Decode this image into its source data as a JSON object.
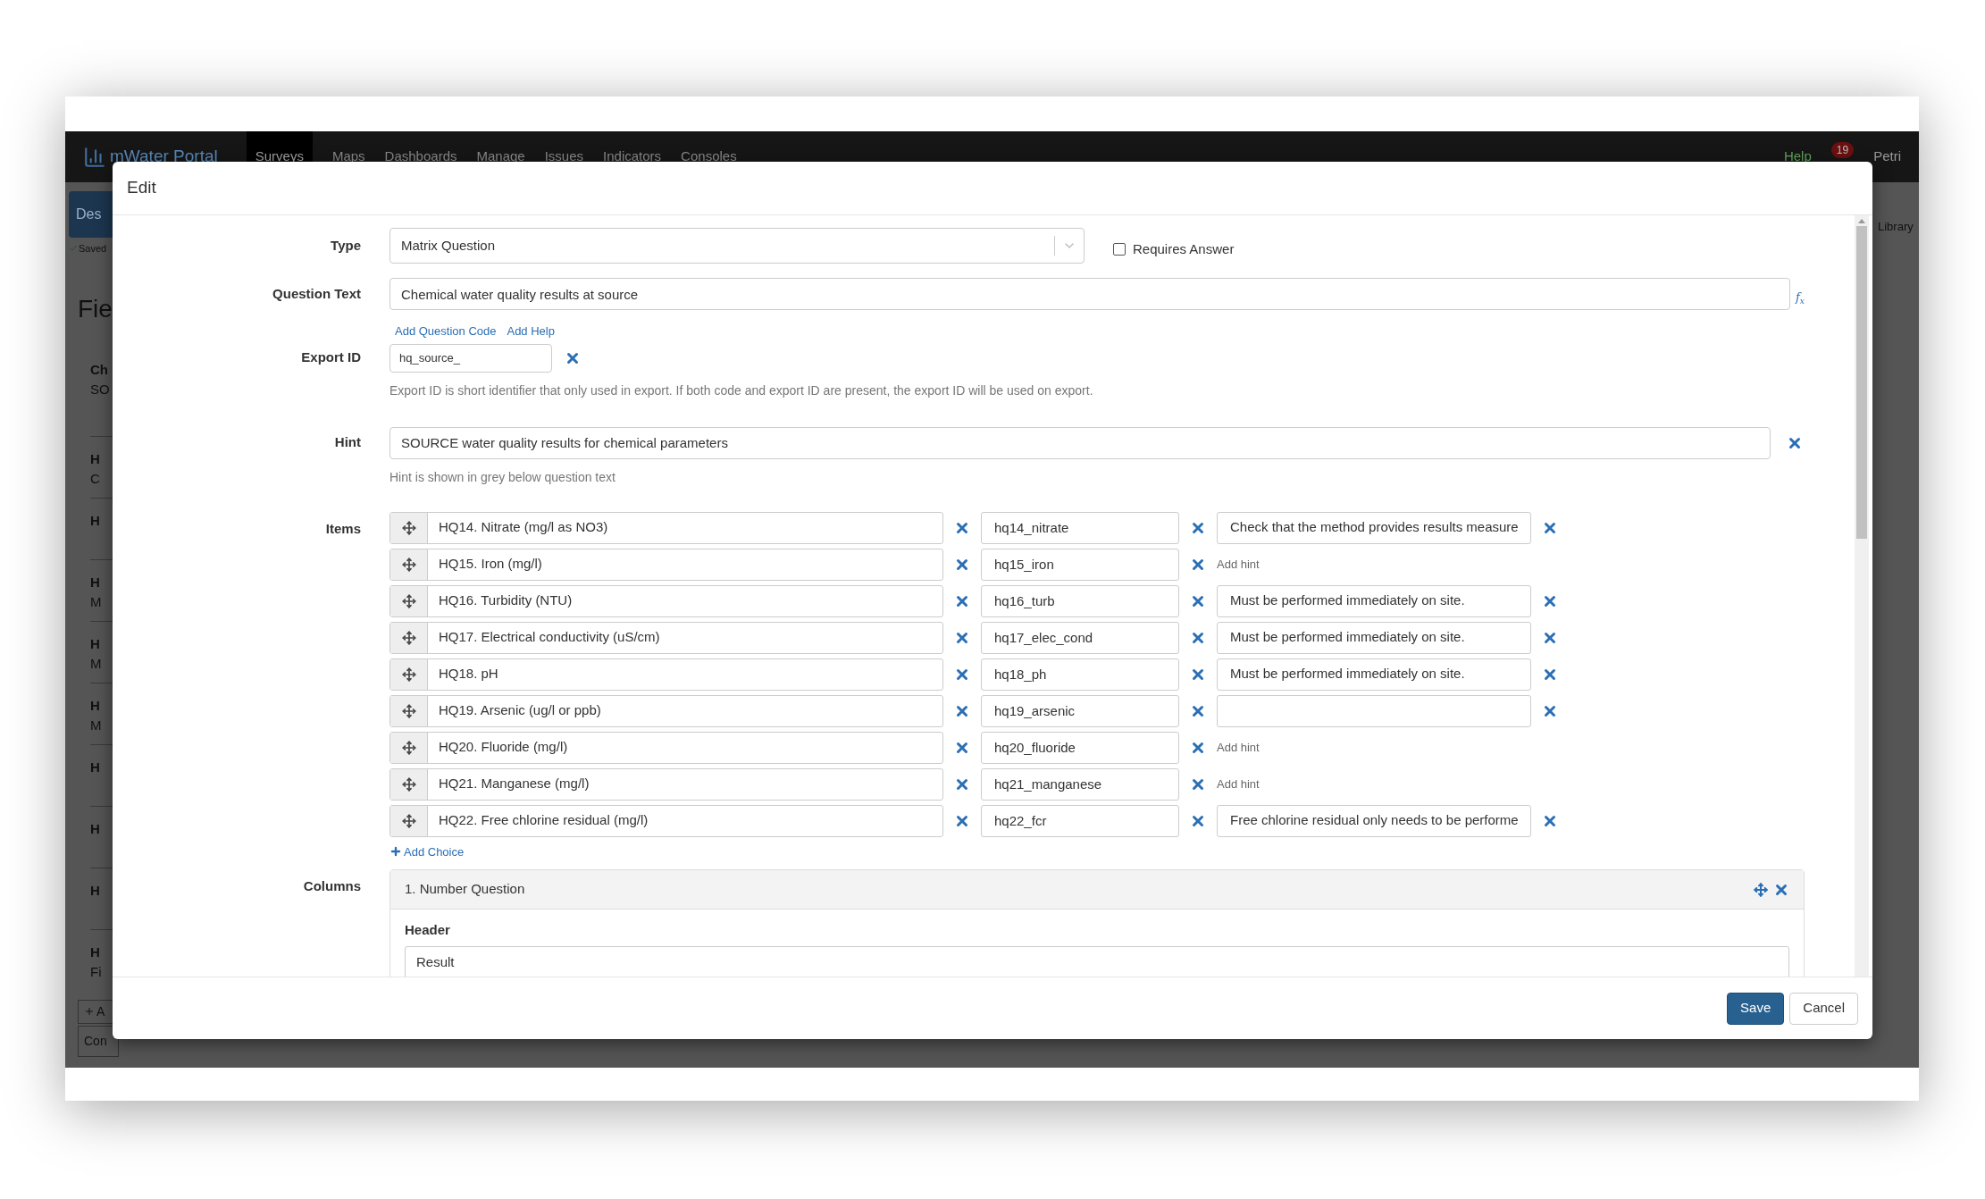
{
  "app": {
    "logo": "mWater Portal",
    "nav": [
      {
        "label": "Surveys",
        "selected": true
      },
      {
        "label": "Maps",
        "selected": false
      },
      {
        "label": "Dashboards",
        "selected": false
      },
      {
        "label": "Manage",
        "selected": false
      },
      {
        "label": "Issues",
        "selected": false
      },
      {
        "label": "Indicators",
        "selected": false
      },
      {
        "label": "Consoles",
        "selected": false
      }
    ],
    "help": "Help",
    "notifications": "19",
    "user": "Petri",
    "design_button": "Des",
    "saved": "Saved",
    "heading": "Fie",
    "library": "Library",
    "section": {
      "title": "Ch",
      "subtitle": "SO"
    },
    "rows": [
      {
        "title": "H",
        "subtitle": "C"
      },
      {
        "title": "H"
      },
      {
        "title": "H",
        "subtitle": "M"
      },
      {
        "title": "H",
        "subtitle": "M"
      },
      {
        "title": "H",
        "subtitle": "M"
      },
      {
        "title": "H"
      },
      {
        "title": "H"
      },
      {
        "title": "H"
      },
      {
        "title": "H",
        "subtitle": "Fi"
      }
    ],
    "add_button": "A",
    "bottom_button": "Con"
  },
  "dialog": {
    "title": "Edit",
    "type": {
      "label": "Type",
      "value": "Matrix Question"
    },
    "requires_answer": {
      "label": "Requires Answer",
      "checked": false
    },
    "question_text": {
      "label": "Question Text",
      "value": "Chemical water quality results at source",
      "formula": "f",
      "formula_sub": "x"
    },
    "links": [
      "Add Question Code",
      "Add Help"
    ],
    "export_id": {
      "label": "Export ID",
      "value": "hq_source_",
      "help": "Export ID is short identifier that only used in export. If both code and export ID are present, the export ID will be used on export."
    },
    "hint": {
      "label": "Hint",
      "value": "SOURCE water quality results for chemical parameters",
      "help": "Hint is shown in grey below question text"
    },
    "items_label": "Items",
    "items": [
      {
        "label": "HQ14. Nitrate (mg/l as NO3)",
        "code": "hq14_nitrate",
        "kind": "field",
        "hint": "Check that the method provides results measure"
      },
      {
        "label": "HQ15. Iron (mg/l)",
        "code": "hq15_iron",
        "kind": "link",
        "hint": "Add hint"
      },
      {
        "label": "HQ16. Turbidity (NTU)",
        "code": "hq16_turb",
        "kind": "field",
        "hint": "Must be performed immediately on site."
      },
      {
        "label": "HQ17. Electrical conductivity (uS/cm)",
        "code": "hq17_elec_cond",
        "kind": "field",
        "hint": "Must be performed immediately on site."
      },
      {
        "label": "HQ18. pH",
        "code": "hq18_ph",
        "kind": "field",
        "hint": "Must be performed immediately on site."
      },
      {
        "label": "HQ19. Arsenic (ug/l or ppb)",
        "code": "hq19_arsenic",
        "kind": "field"
      },
      {
        "label": "HQ20. Fluoride (mg/l)",
        "code": "hq20_fluoride",
        "kind": "link",
        "hint": "Add hint"
      },
      {
        "label": "HQ21. Manganese (mg/l)",
        "code": "hq21_manganese",
        "kind": "link",
        "hint": "Add hint"
      },
      {
        "label": "HQ22. Free chlorine residual (mg/l)",
        "code": "hq22_fcr",
        "kind": "field",
        "hint": "Free chlorine residual only needs to be performe"
      }
    ],
    "add_choice": "Add Choice",
    "columns_label": "Columns",
    "column": {
      "title": "1. Number Question",
      "header_label": "Header",
      "header_value": "Result"
    },
    "buttons": {
      "save": "Save",
      "cancel": "Cancel"
    }
  }
}
